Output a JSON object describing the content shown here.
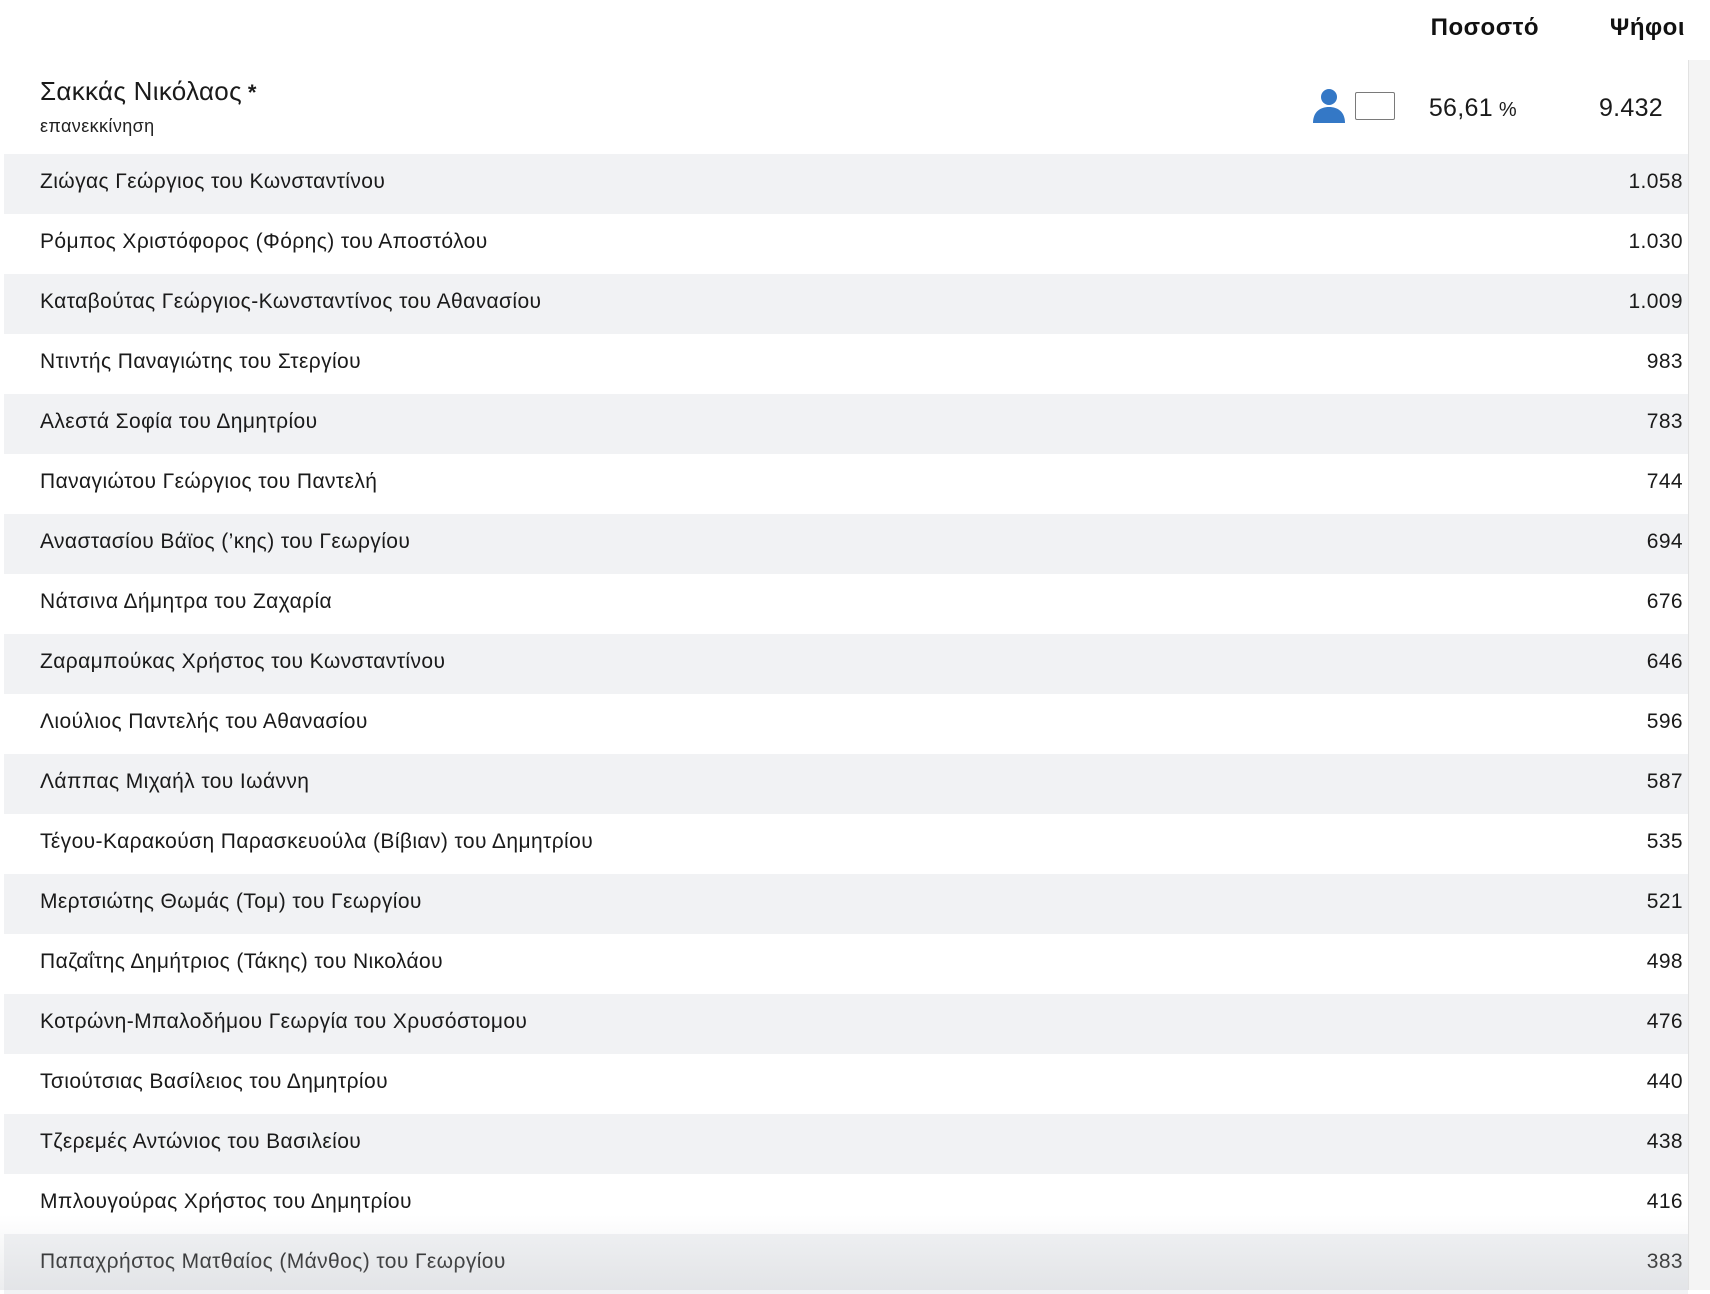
{
  "columns": {
    "percentage_label": "Ποσοστό",
    "votes_label": "Ψήφοι"
  },
  "winner": {
    "name": "Σακκάς Νικόλαος",
    "marker": "*",
    "status": "επανεκκίνηση",
    "percentage": "56,61",
    "percentage_unit": "%",
    "votes": "9.432",
    "icon": "person-icon",
    "accent_color": "#3478c6"
  },
  "candidates": [
    {
      "name": "Ζιώγας Γεώργιος του Κωνσταντίνου",
      "votes": "1.058"
    },
    {
      "name": "Ρόμπος Χριστόφορος (Φόρης) του Αποστόλου",
      "votes": "1.030"
    },
    {
      "name": "Καταβούτας Γεώργιος-Κωνσταντίνος του Αθανασίου",
      "votes": "1.009"
    },
    {
      "name": "Ντιντής Παναγιώτης του Στεργίου",
      "votes": "983"
    },
    {
      "name": "Αλεστά Σοφία του Δημητρίου",
      "votes": "783"
    },
    {
      "name": "Παναγιώτου Γεώργιος του Παντελή",
      "votes": "744"
    },
    {
      "name": "Αναστασίου Βάϊος (’κης) του Γεωργίου",
      "votes": "694"
    },
    {
      "name": "Νάτσινα Δήμητρα του Ζαχαρία",
      "votes": "676"
    },
    {
      "name": "Ζαραμπούκας Χρήστος του Κωνσταντίνου",
      "votes": "646"
    },
    {
      "name": "Λιούλιος Παντελής του Αθανασίου",
      "votes": "596"
    },
    {
      "name": "Λάππας Μιχαήλ του Ιωάννη",
      "votes": "587"
    },
    {
      "name": "Τέγου-Καρακούση Παρασκευούλα (Βίβιαν) του Δημητρίου",
      "votes": "535"
    },
    {
      "name": "Μερτσιώτης Θωμάς (Τομ) του Γεωργίου",
      "votes": "521"
    },
    {
      "name": "Παζαΐτης Δημήτριος (Τάκης) του Νικολάου",
      "votes": "498"
    },
    {
      "name": "Κοτρώνη-Μπαλοδήμου Γεωργία του Χρυσόστομου",
      "votes": "476"
    },
    {
      "name": "Τσιούτσιας Βασίλειος του Δημητρίου",
      "votes": "440"
    },
    {
      "name": "Τζερεμές Αντώνιος του Βασιλείου",
      "votes": "438"
    },
    {
      "name": "Μπλουγούρας Χρήστος του Δημητρίου",
      "votes": "416"
    },
    {
      "name": "Παπαχρήστος Ματθαίος (Μάνθος) του Γεωργίου",
      "votes": "383"
    }
  ]
}
